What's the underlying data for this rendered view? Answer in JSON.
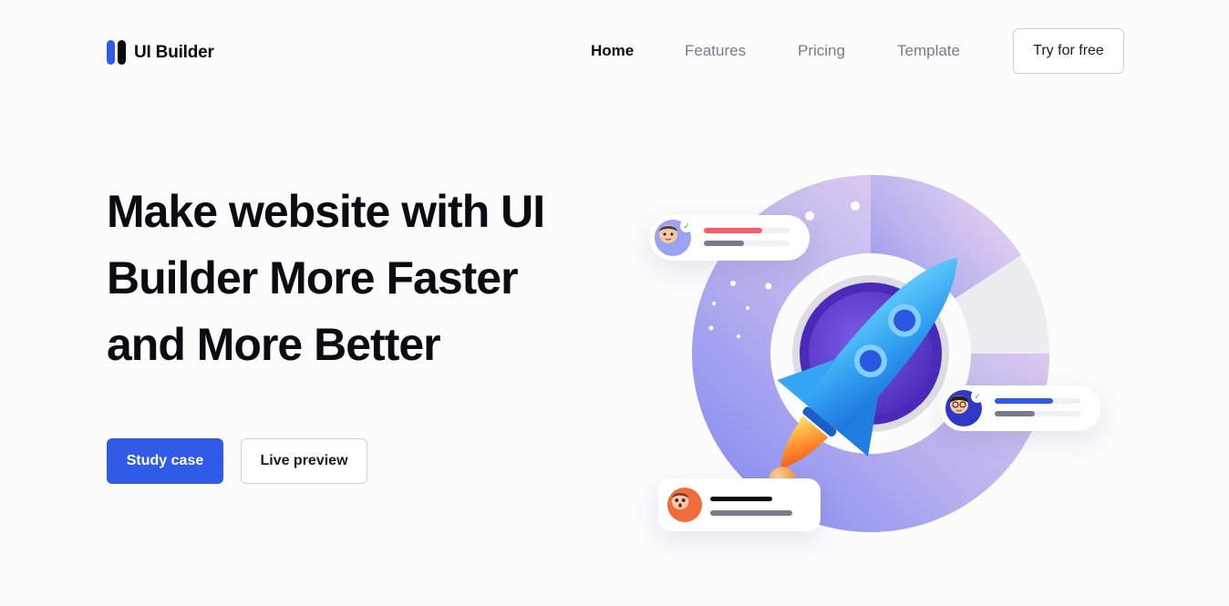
{
  "brand": {
    "name": "UI Builder",
    "accent": "#2f5be8"
  },
  "nav": {
    "items": [
      {
        "label": "Home",
        "active": true
      },
      {
        "label": "Features",
        "active": false
      },
      {
        "label": "Pricing",
        "active": false
      },
      {
        "label": "Template",
        "active": false
      }
    ],
    "cta_label": "Try for free"
  },
  "hero": {
    "title_lines": [
      "Make website with UI",
      "Builder More Faster",
      "and More Better"
    ],
    "primary_label": "Study case",
    "secondary_label": "Live preview"
  },
  "illustration": {
    "icons": [
      "rocket-icon",
      "avatar-male-icon",
      "avatar-bespectacled-icon",
      "avatar-surprised-icon",
      "check-icon"
    ]
  }
}
